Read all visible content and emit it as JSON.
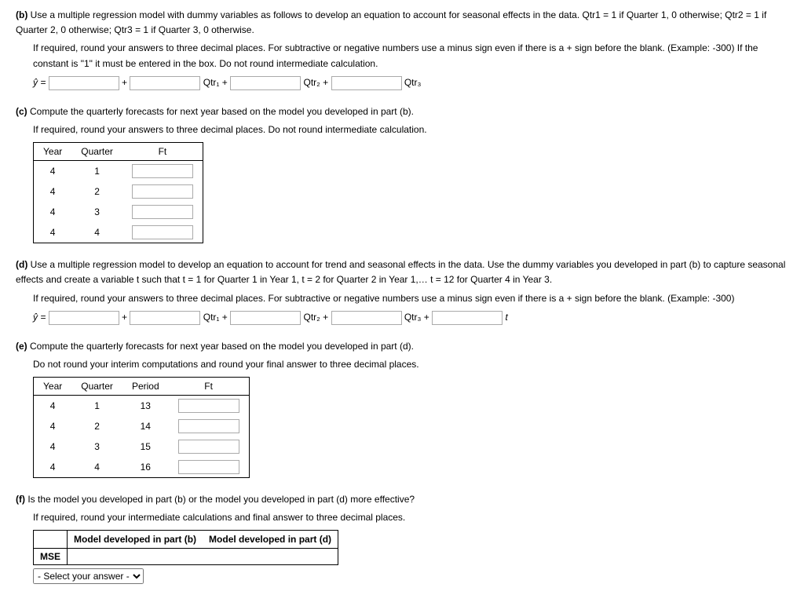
{
  "partB": {
    "label": "(b)",
    "mainText": "Use a multiple regression model with dummy variables as follows to develop an equation to account for seasonal effects in the data. Qtr1 = 1 if Quarter 1, 0 otherwise; Qtr2 = 1 if Quarter 2, 0 otherwise; Qtr3 = 1 if Quarter 3, 0 otherwise.",
    "subText1": "If required, round your answers to three decimal places. For subtractive or negative numbers use a minus sign even if there is a + sign before the blank. (Example: -300) If the constant is \"1\" it must be entered in the box. Do not round intermediate calculation.",
    "eq": {
      "yhat": "ŷ =",
      "plus": "+",
      "qtr1": "Qtr₁ +",
      "qtr2": "Qtr₂ +",
      "qtr3": "Qtr₃"
    }
  },
  "partC": {
    "label": "(c)",
    "mainText": "Compute the quarterly forecasts for next year based on the model you developed in part (b).",
    "subText1": "If required, round your answers to three decimal places. Do not round intermediate calculation.",
    "headers": {
      "year": "Year",
      "quarter": "Quarter",
      "ft": "Ft"
    },
    "rows": [
      {
        "year": "4",
        "quarter": "1"
      },
      {
        "year": "4",
        "quarter": "2"
      },
      {
        "year": "4",
        "quarter": "3"
      },
      {
        "year": "4",
        "quarter": "4"
      }
    ]
  },
  "partD": {
    "label": "(d)",
    "mainText": "Use a multiple regression model to develop an equation to account for trend and seasonal effects in the data. Use the dummy variables you developed in part (b) to capture seasonal effects and create a variable t such that t = 1 for Quarter 1 in Year 1, t = 2 for Quarter 2 in Year 1,… t = 12 for Quarter 4 in Year 3.",
    "subText1": "If required, round your answers to three decimal places. For subtractive or negative numbers use a minus sign even if there is a + sign before the blank. (Example: -300)",
    "eq": {
      "yhat": "ŷ =",
      "plus": "+",
      "qtr1": "Qtr₁ +",
      "qtr2": "Qtr₂ +",
      "qtr3": "Qtr₃ +",
      "t": "t"
    }
  },
  "partE": {
    "label": "(e)",
    "mainText": "Compute the quarterly forecasts for next year based on the model you developed in part (d).",
    "subText1": "Do not round your interim computations and round your final answer to three decimal places.",
    "headers": {
      "year": "Year",
      "quarter": "Quarter",
      "period": "Period",
      "ft": "Ft"
    },
    "rows": [
      {
        "year": "4",
        "quarter": "1",
        "period": "13"
      },
      {
        "year": "4",
        "quarter": "2",
        "period": "14"
      },
      {
        "year": "4",
        "quarter": "3",
        "period": "15"
      },
      {
        "year": "4",
        "quarter": "4",
        "period": "16"
      }
    ]
  },
  "partF": {
    "label": "(f)",
    "mainText": "Is the model you developed in part (b) or the model you developed in part (d) more effective?",
    "subText1": "If required, round your intermediate calculations and final answer to three decimal places.",
    "headers": {
      "modelB": "Model developed in part (b)",
      "modelD": "Model developed in part (d)"
    },
    "rowLabel": "MSE",
    "selectPlaceholder": "- Select your answer -"
  }
}
